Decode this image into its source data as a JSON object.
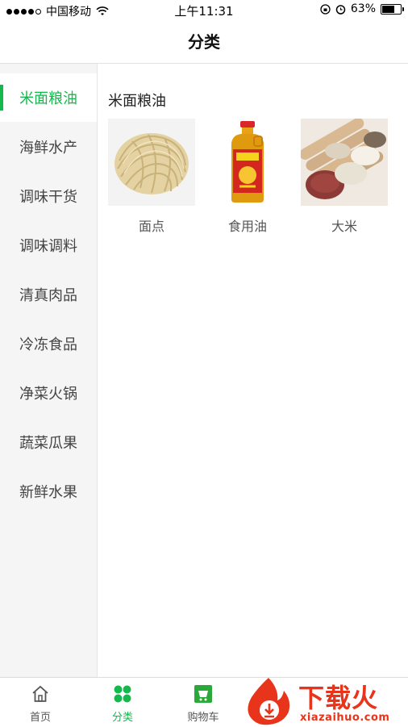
{
  "status_bar": {
    "carrier": "中国移动",
    "time": "上午11:31",
    "battery_percent": "63%"
  },
  "navbar": {
    "title": "分类"
  },
  "sidebar": {
    "items": [
      {
        "label": "米面粮油",
        "active": true
      },
      {
        "label": "海鲜水产"
      },
      {
        "label": "调味干货"
      },
      {
        "label": "调味调料"
      },
      {
        "label": "清真肉品"
      },
      {
        "label": "冷冻食品"
      },
      {
        "label": "净菜火锅"
      },
      {
        "label": "蔬菜瓜果"
      },
      {
        "label": "新鲜水果"
      }
    ]
  },
  "main": {
    "section_title": "米面粮油",
    "categories": [
      {
        "label": "面点",
        "image": "noodles"
      },
      {
        "label": "食用油",
        "image": "cooking-oil-bottle"
      },
      {
        "label": "大米",
        "image": "rice-scoops"
      }
    ]
  },
  "tabbar": {
    "tabs": [
      {
        "label": "首页",
        "icon": "home-icon"
      },
      {
        "label": "分类",
        "icon": "category-grid-icon",
        "active": true
      },
      {
        "label": "购物车",
        "icon": "cart-icon"
      }
    ]
  },
  "watermark": {
    "text": "下载火",
    "url": "xiazaihuo.com"
  },
  "colors": {
    "accent": "#15b84d",
    "sidebar_bg": "#f5f5f5",
    "watermark": "#e8341b"
  }
}
